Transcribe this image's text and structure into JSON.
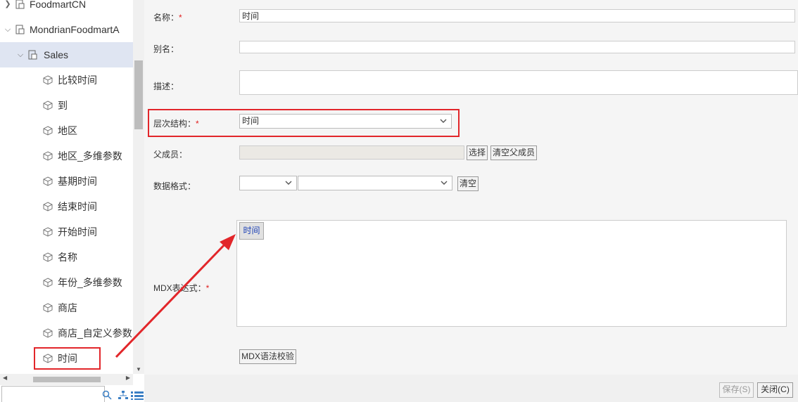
{
  "tree": {
    "nodes": [
      {
        "label": "FoodmartCN",
        "expanded": false,
        "selected": false
      },
      {
        "label": "MondrianFoodmartA",
        "expanded": true,
        "selected": false
      },
      {
        "label": "Sales",
        "expanded": true,
        "selected": true
      },
      {
        "label": "比较时间"
      },
      {
        "label": "到"
      },
      {
        "label": "地区"
      },
      {
        "label": "地区_多维参数"
      },
      {
        "label": "基期时间"
      },
      {
        "label": "结束时间"
      },
      {
        "label": "开始时间"
      },
      {
        "label": "名称"
      },
      {
        "label": "年份_多维参数"
      },
      {
        "label": "商店"
      },
      {
        "label": "商店_自定义参数"
      },
      {
        "label": "时间",
        "highlighted": true
      }
    ],
    "search_value": ""
  },
  "form": {
    "name": {
      "label": "名称：",
      "required": "*",
      "value": "时间"
    },
    "alias": {
      "label": "别名：",
      "value": ""
    },
    "description": {
      "label": "描述：",
      "value": ""
    },
    "hierarchy": {
      "label": "层次结构：",
      "required": "*",
      "value": "时间"
    },
    "parent": {
      "label": "父成员：",
      "value": "",
      "select_button": "选择",
      "clear_button": "清空父成员"
    },
    "data_format": {
      "label": "数据格式：",
      "value1": "",
      "value2": "",
      "clear_button": "清空"
    },
    "mdx": {
      "label": "MDX表达式：",
      "required": "*",
      "token": "时间",
      "check_button": "MDX语法校验"
    }
  },
  "footer": {
    "save_label": "保存(S)",
    "close_label": "关闭(C)"
  },
  "colors": {
    "highlight_red": "#e2262a",
    "selected_bg": "#dfe5f2",
    "token_text": "#1a3fb5"
  }
}
